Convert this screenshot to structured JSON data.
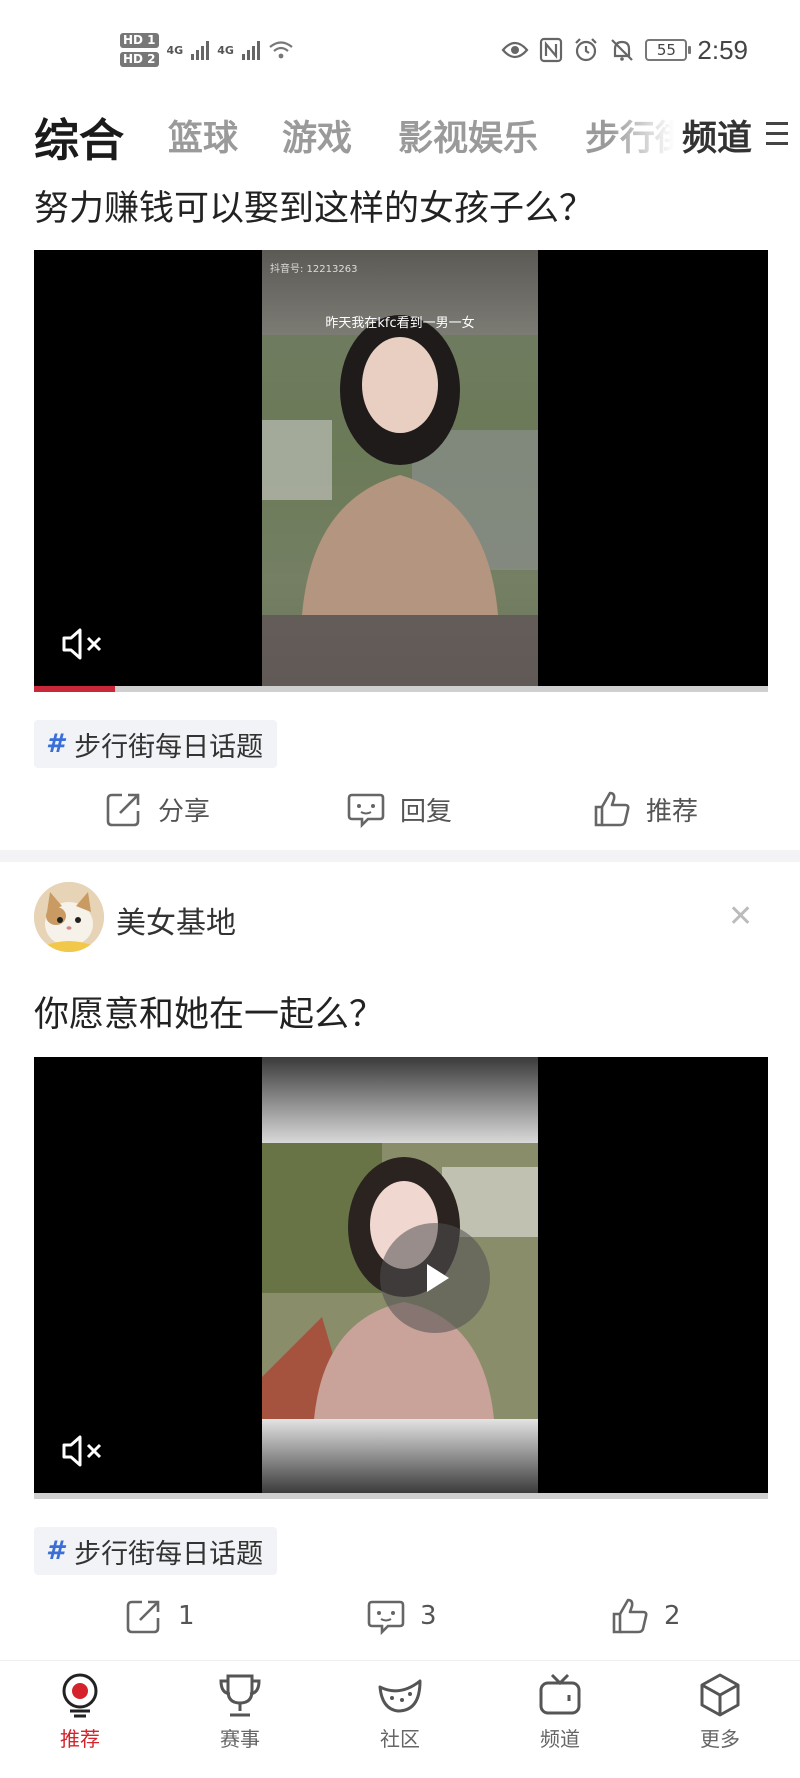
{
  "status_bar": {
    "hd1": "HD 1",
    "hd2": "HD 2",
    "net1": "4G",
    "net2": "4G",
    "battery": "55",
    "time": "2:59"
  },
  "tabs": [
    {
      "label": "综合",
      "active": true
    },
    {
      "label": "篮球",
      "active": false
    },
    {
      "label": "游戏",
      "active": false
    },
    {
      "label": "影视娱乐",
      "active": false
    },
    {
      "label": "步行街",
      "active": false
    }
  ],
  "channel_label": "频道",
  "posts": [
    {
      "title": "努力赚钱可以娶到这样的女孩子么？",
      "video": {
        "caption": "昨天我在kfc看到一男一女",
        "watermark": "抖音号: 12213263",
        "progress": 0.11,
        "playing": true
      },
      "topic": "步行街每日话题",
      "actions": {
        "share": "分享",
        "reply": "回复",
        "like": "推荐"
      }
    },
    {
      "author": "美女基地",
      "title": "你愿意和她在一起么？",
      "video": {
        "progress": 0.0,
        "playing": false
      },
      "topic": "步行街每日话题",
      "actions": {
        "share": "1",
        "reply": "3",
        "like": "2"
      }
    }
  ],
  "bottom_nav": [
    {
      "label": "推荐",
      "icon": "recommend-icon",
      "active": true
    },
    {
      "label": "赛事",
      "icon": "trophy-icon",
      "active": false
    },
    {
      "label": "社区",
      "icon": "watermelon-icon",
      "active": false
    },
    {
      "label": "频道",
      "icon": "tv-icon",
      "active": false
    },
    {
      "label": "更多",
      "icon": "cube-icon",
      "active": false
    }
  ],
  "colors": {
    "accent": "#d4232b",
    "topic_hash": "#3b6fd8",
    "progress": "#c8283a"
  }
}
